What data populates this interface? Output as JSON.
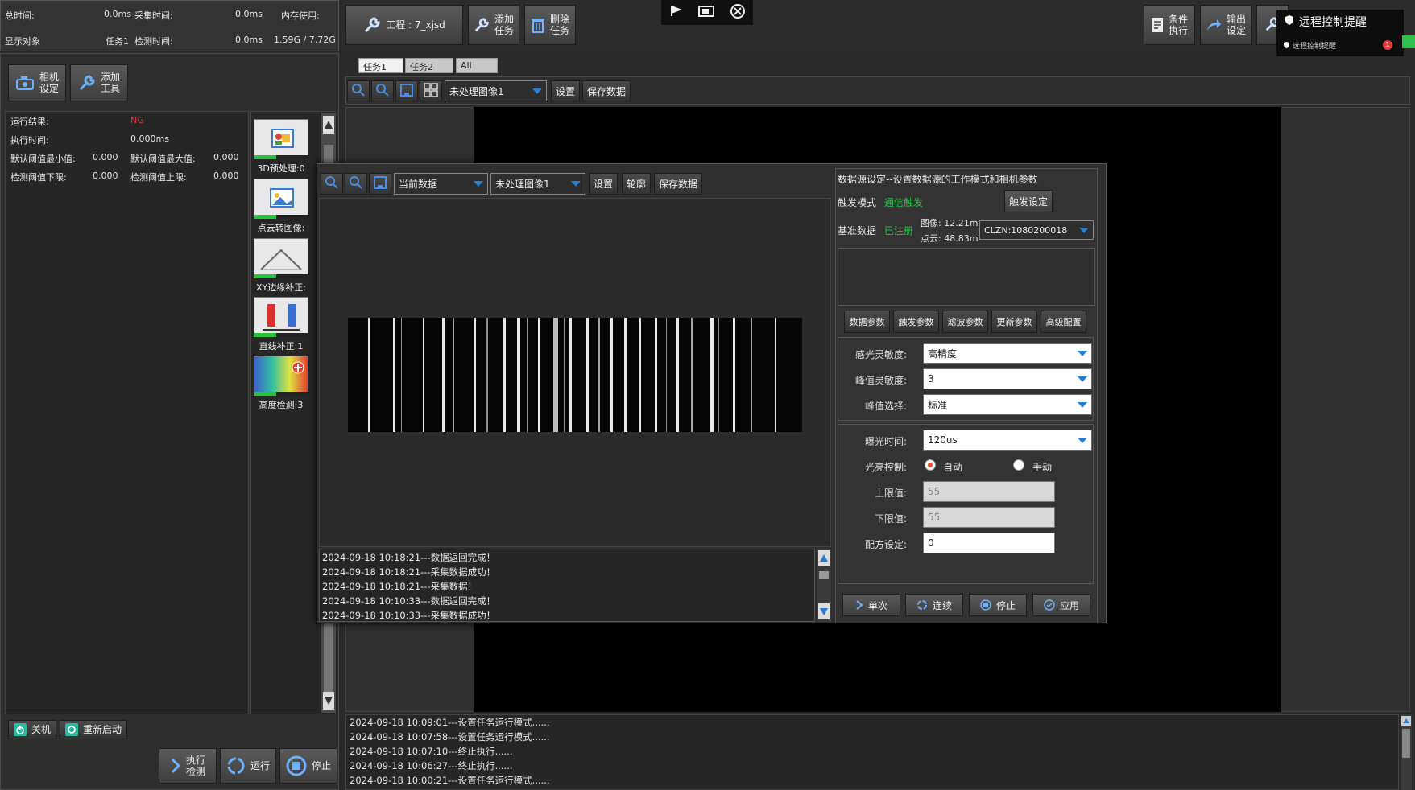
{
  "status": {
    "total_time_label": "总时间:",
    "total_time_value": "0.0ms",
    "capture_time_label": "采集时间:",
    "capture_time_value": "0.0ms",
    "memory_label": "内存使用:",
    "display_label": "显示对象",
    "display_value": "任务1",
    "detect_time_label": "检测时间:",
    "detect_time_value": "0.0ms",
    "memory_value": "1.59G / 7.72G"
  },
  "toolbar": {
    "project": "工程 : 7_xjsd",
    "add_task": "添加\n任务",
    "delete_task": "删除\n任务",
    "cond_exec": "条件\n执行",
    "output_set": "输出\n设定"
  },
  "remote": {
    "title": "远程控制提醒",
    "sub": "远程控制提醒",
    "badge": "1"
  },
  "left": {
    "camera_set": "相机\n设定",
    "add_tool": "添加\n工具",
    "results": [
      {
        "label": "运行结果:",
        "value": "NG"
      },
      {
        "label": "执行时间:",
        "value": "0.000ms"
      }
    ],
    "thresholds": [
      {
        "l1": "默认阈值最小值:",
        "v1": "0.000",
        "l2": "默认阈值最大值:",
        "v2": "0.000"
      },
      {
        "l1": "检测阈值下限:",
        "v1": "0.000",
        "l2": "检测阈值上限:",
        "v2": "0.000"
      }
    ],
    "tools": [
      "3D预处理:0",
      "点云转图像:",
      "XY边缘补正:",
      "直线补正:1",
      "高度检测:3"
    ],
    "shutdown": "关机",
    "restart": "重新启动",
    "exec_detect": "执行\n检测",
    "run": "运行",
    "stop": "停止"
  },
  "tabs": [
    "任务1",
    "任务2",
    "All"
  ],
  "main_toolbar": {
    "image_select": "未处理图像1",
    "settings": "设置",
    "save": "保存数据"
  },
  "dialog": {
    "data_select": "当前数据",
    "image_select": "未处理图像1",
    "settings": "设置",
    "contour": "轮廓",
    "save": "保存数据",
    "log": [
      "2024-09-18 10:18:21---数据返回完成！",
      "2024-09-18 10:18:21---采集数据成功！",
      "2024-09-18 10:18:21---采集数据！",
      "2024-09-18 10:10:33---数据返回完成！",
      "2024-09-18 10:10:33---采集数据成功！"
    ],
    "ds_title": "数据源设定--设置数据源的工作模式和相机参数",
    "trigger_mode_label": "触发模式",
    "trigger_mode_value": "通信触发",
    "trigger_set": "触发设定",
    "base_data_label": "基准数据",
    "base_data_value": "已注册",
    "image_size": "图像: 12.21m",
    "cloud_size": "点云: 48.83m",
    "device": "CLZN:1080200018",
    "param_tabs": [
      "数据参数",
      "触发参数",
      "滤波参数",
      "更新参数",
      "高级配置"
    ],
    "sensitivity_label": "感光灵敏度:",
    "sensitivity_value": "高精度",
    "peak_sens_label": "峰值灵敏度:",
    "peak_sens_value": "3",
    "peak_sel_label": "峰值选择:",
    "peak_sel_value": "标准",
    "exposure_label": "曝光时间:",
    "exposure_value": "120us",
    "light_label": "光亮控制:",
    "light_auto": "自动",
    "light_manual": "手动",
    "upper_label": "上限值:",
    "upper_value": "55",
    "lower_label": "下限值:",
    "lower_value": "55",
    "recipe_label": "配方设定:",
    "recipe_value": "0",
    "single": "单次",
    "continuous": "连续",
    "stop": "停止",
    "apply": "应用"
  },
  "bottom_log": [
    "2024-09-18 10:09:01---设置任务运行模式......",
    "2024-09-18 10:07:58---设置任务运行模式......",
    "2024-09-18 10:07:10---终止执行......",
    "2024-09-18 10:06:27---终止执行......",
    "2024-09-18 10:00:21---设置任务运行模式......"
  ],
  "colors": {
    "ng": "#e53030",
    "ok_green": "#2ec04a",
    "accent": "#2b7bd1"
  }
}
